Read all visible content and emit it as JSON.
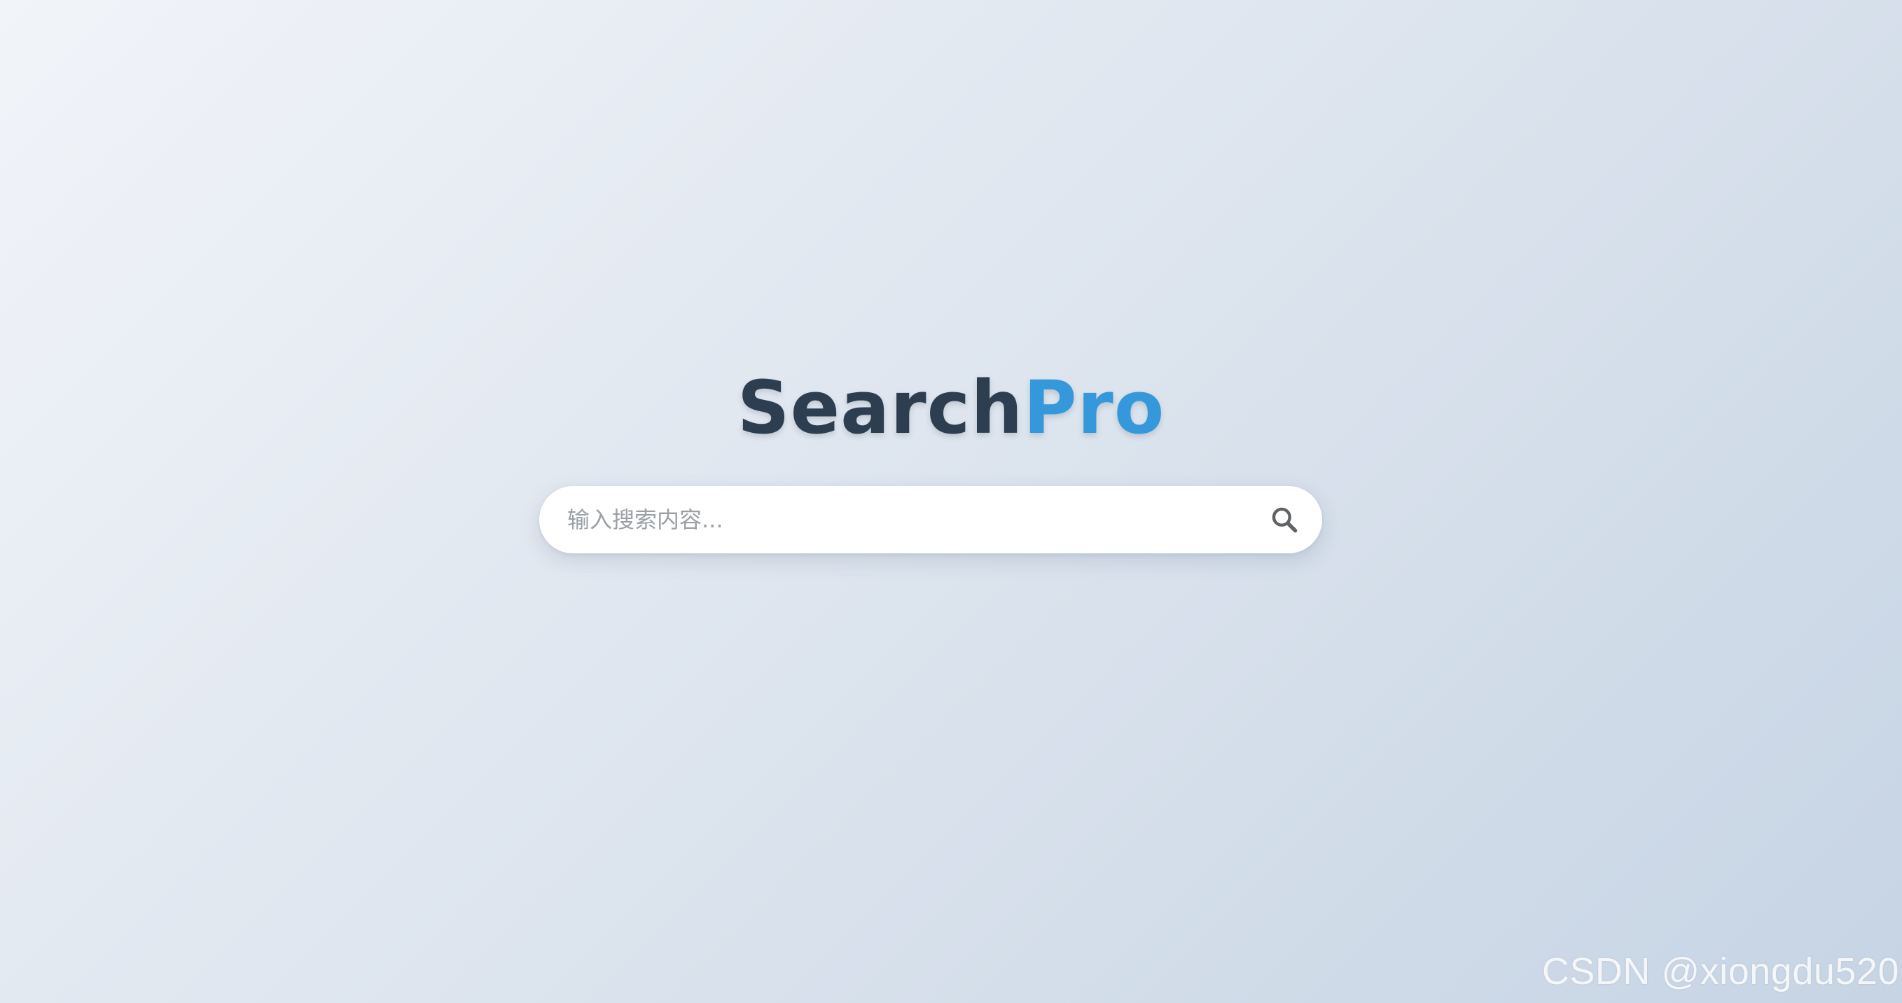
{
  "logo": {
    "part1": "Search",
    "part2": "Pro"
  },
  "search": {
    "value": "",
    "placeholder": "输入搜索内容...",
    "button_icon": "search-icon"
  },
  "watermark": {
    "text": "CSDN @xiongdu520"
  },
  "colors": {
    "logo_dark": "#2c3e50",
    "logo_accent": "#3498db",
    "icon": "#5f6368",
    "placeholder": "#9aa0a6"
  }
}
